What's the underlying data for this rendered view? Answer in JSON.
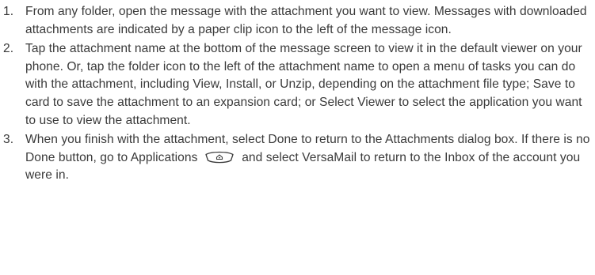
{
  "steps": [
    {
      "number": "1.",
      "text": "From any folder, open the message with the attachment you want to view. Messages with downloaded attachments are indicated by a paper clip icon to the left of the message icon."
    },
    {
      "number": "2.",
      "text": "Tap the attachment name at the bottom of the message screen to view it in the default viewer on your phone. Or, tap the folder icon to the left of the attachment name to open a menu of tasks you can do with the attachment, including View, Install, or Unzip, depending on the attachment file type; Save to card to save the attachment to an expansion card; or Select Viewer to select the application you want to use to view the attachment."
    },
    {
      "number": "3.",
      "text_before_icon": "When you finish with the attachment, select Done to return to the Attachments dialog box. If there is no Done button, go to Applications",
      "icon": "applications-key-icon",
      "text_after_icon": "and select VersaMail to return to the Inbox of the account you were in."
    }
  ]
}
